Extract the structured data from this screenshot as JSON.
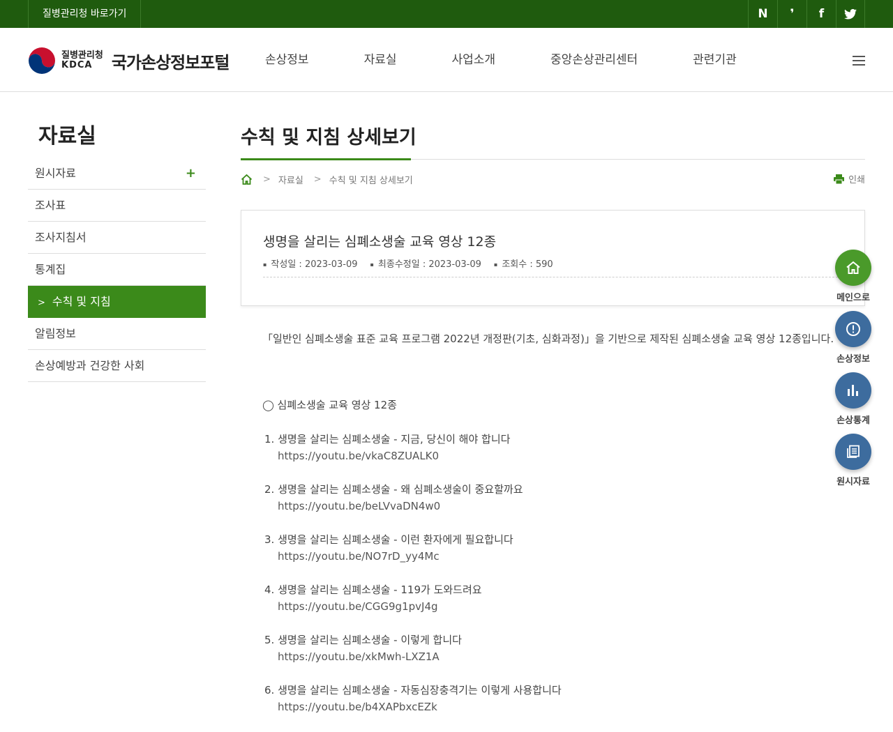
{
  "topbar": {
    "kdca_link": "질병관리청 바로가기",
    "social": [
      {
        "icon": "naver-blog-icon",
        "glyph": "N"
      },
      {
        "icon": "post-icon",
        "glyph": "❜"
      },
      {
        "icon": "facebook-icon",
        "glyph": "f"
      },
      {
        "icon": "twitter-icon",
        "glyph": "🐦"
      }
    ]
  },
  "header": {
    "logo_org_ko": "질병관리청",
    "logo_org_en": "KDCA",
    "portal_name": "국가손상정보포털",
    "gnb": [
      "손상정보",
      "자료실",
      "사업소개",
      "중앙손상관리센터",
      "관련기관"
    ]
  },
  "sidebar": {
    "title": "자료실",
    "items": [
      {
        "label": "원시자료",
        "has_children": true
      },
      {
        "label": "조사표"
      },
      {
        "label": "조사지침서"
      },
      {
        "label": "통계집"
      },
      {
        "label": "수칙 및 지침",
        "active": true
      },
      {
        "label": "알림정보"
      },
      {
        "label": "손상예방과 건강한 사회"
      }
    ]
  },
  "content": {
    "page_title": "수칙 및 지침 상세보기",
    "breadcrumb": [
      "자료실",
      "수칙 및 지침 상세보기"
    ],
    "print_label": "인쇄",
    "post": {
      "title": "생명을 살리는 심폐소생술 교육 영상 12종",
      "created": "작성일 : 2023-03-09",
      "modified": "최종수정일 : 2023-03-09",
      "views": "조회수 : 590"
    },
    "body": "「일반인 심폐소생술 표준 교육 프로그램 2022년 개정판(기초, 심화과정)」을 기반으로 제작된 심폐소생술 교육 영상 12종입니다.",
    "list_title": "◯ 심폐소생술 교육 영상 12종",
    "videos": [
      {
        "title": "1. 생명을 살리는 심폐소생술 - 지금, 당신이 해야 합니다",
        "url": "https://youtu.be/vkaC8ZUALK0"
      },
      {
        "title": "2. 생명을 살리는 심폐소생술 - 왜 심폐소생술이 중요할까요",
        "url": "https://youtu.be/beLVvaDN4w0"
      },
      {
        "title": "3. 생명을 살리는 심폐소생술 - 이런 환자에게 필요합니다",
        "url": "https://youtu.be/NO7rD_yy4Mc"
      },
      {
        "title": "4. 생명을 살리는 심폐소생술 - 119가 도와드려요",
        "url": "https://youtu.be/CGG9g1pvJ4g"
      },
      {
        "title": "5. 생명을 살리는 심폐소생술 - 이렇게 합니다",
        "url": "https://youtu.be/xkMwh-LXZ1A"
      },
      {
        "title": "6. 생명을 살리는 심폐소생술 - 자동심장충격기는 이렇게 사용합니다",
        "url": "https://youtu.be/b4XAPbxcEZk"
      }
    ]
  },
  "quick_menu": [
    {
      "label": "메인으로",
      "icon": "home-icon",
      "color": "#4a9a2a"
    },
    {
      "label": "손상정보",
      "icon": "alert-icon",
      "color": "#3d6c9e"
    },
    {
      "label": "손상통계",
      "icon": "bar-chart-icon",
      "color": "#3d6c9e"
    },
    {
      "label": "원시자료",
      "icon": "document-icon",
      "color": "#3d6c9e"
    }
  ],
  "colors": {
    "topbar": "#1f5b0e",
    "accent": "#3b8a1a",
    "quick_blue": "#3d6c9e"
  }
}
